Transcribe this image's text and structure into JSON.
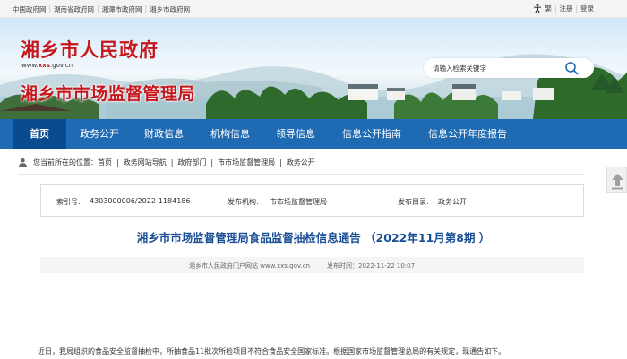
{
  "topbar": {
    "links": [
      "中国政府网",
      "湖南省政府网",
      "湘潭市政府网",
      "湘乡市政府网"
    ],
    "traditional": "繁",
    "register": "注册",
    "login": "登录"
  },
  "banner": {
    "city_name": "湘乡市人民政府",
    "url_prefix": "www.",
    "url_domain": "xxs",
    "url_suffix": ".gov.cn",
    "bureau_name": "湘乡市市场监督管理局",
    "search_placeholder": "请输入检索关键字"
  },
  "nav": {
    "items": [
      {
        "label": "首页"
      },
      {
        "label": "政务公开"
      },
      {
        "label": "财政信息"
      },
      {
        "label": "机构信息"
      },
      {
        "label": "领导信息"
      },
      {
        "label": "信息公开指南"
      },
      {
        "label": "信息公开年度报告"
      }
    ]
  },
  "breadcrumb": {
    "lead": "您当前所在的位置：",
    "items": [
      "首页",
      "政务网站导航",
      "政府部门",
      "市市场监督管理局",
      "政务公开"
    ],
    "separator": "|"
  },
  "meta": {
    "index_label": "索引号:",
    "index_value": "4303000006/2022-1184186",
    "publisher_label": "发布机构:",
    "publisher_value": "市市场监督管理局",
    "catalog_label": "发布目录:",
    "catalog_value": "政务公开"
  },
  "article": {
    "title": "湘乡市市场监督管理局食品监督抽检信息通告 （2022年11月第8期 ）",
    "source": "湘乡市人民政府门户网站 www.xxs.gov.cn",
    "time_label": "发布时间：",
    "time_value": "2022-11-22 10:07",
    "body_first_line": "近日，我局组织的食品安全监督抽检中，所抽食品11批次所检项目不符合食品安全国家标准。根据国家市场监督管理总局的有关规定，现通告如下。"
  },
  "colors": {
    "brand_red": "#c8161d",
    "nav_blue": "#1e6bb3",
    "nav_active": "#0a4a8e",
    "title_blue": "#1a4f95"
  }
}
